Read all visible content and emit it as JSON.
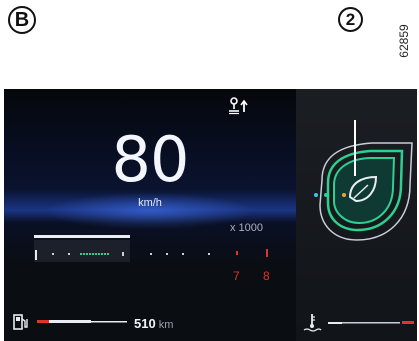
{
  "figure": {
    "badge_letter": "B",
    "reference_code": "62859"
  },
  "dashboard": {
    "navigation_icon": "navigation-arrow-icon",
    "speed": {
      "value": "80",
      "unit": "km/h"
    },
    "tachometer": {
      "multiplier_label": "x 1000",
      "redline_labels": [
        "7",
        "8"
      ],
      "redline_color": "#e0332b"
    },
    "fuel": {
      "icon": "fuel-pump-icon",
      "level_fraction": 0.6,
      "range_value": "510",
      "range_unit": "km"
    },
    "eco_indicator": {
      "icon": "leaf-icon",
      "callout_number": "2",
      "accent_color": "#2bd18e"
    },
    "coolant": {
      "icon": "coolant-temperature-icon",
      "level_fraction": 0.5
    }
  }
}
